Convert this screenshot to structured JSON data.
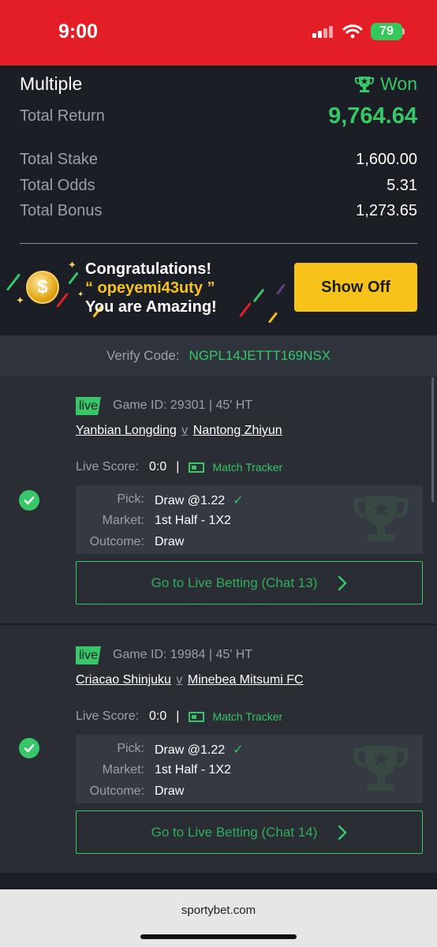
{
  "status_bar": {
    "time": "9:00",
    "battery": "79"
  },
  "summary": {
    "bet_type": "Multiple",
    "status": "Won",
    "total_return_label": "Total Return",
    "total_return": "9,764.64",
    "rows": [
      {
        "label": "Total Stake",
        "value": "1,600.00"
      },
      {
        "label": "Total Odds",
        "value": "5.31"
      },
      {
        "label": "Total Bonus",
        "value": "1,273.65"
      }
    ]
  },
  "congrats": {
    "title": "Congratulations!",
    "user": "“ opeyemi43uty ”",
    "subtitle": "You are Amazing!",
    "button": "Show Off"
  },
  "verify": {
    "label": "Verify Code:",
    "code": "NGPL14JETTT169NSX"
  },
  "games": [
    {
      "live": "live",
      "game_id": "Game ID: 29301 | 45' HT",
      "home": "Yanbian Longding",
      "vs": "v",
      "away": "Nantong Zhiyun",
      "live_score_label": "Live Score:",
      "score": "0:0",
      "separator": "|",
      "tracker": "Match Tracker",
      "pick_label": "Pick:",
      "pick": "Draw @1.22",
      "market_label": "Market:",
      "market": "1st Half - 1X2",
      "outcome_label": "Outcome:",
      "outcome": "Draw",
      "button": "Go to Live Betting (Chat 13)"
    },
    {
      "live": "live",
      "game_id": "Game ID: 19984 | 45' HT",
      "home": "Criacao Shinjuku",
      "vs": "v",
      "away": "Minebea Mitsumi FC",
      "live_score_label": "Live Score:",
      "score": "0:0",
      "separator": "|",
      "tracker": "Match Tracker",
      "pick_label": "Pick:",
      "pick": "Draw @1.22",
      "market_label": "Market:",
      "market": "1st Half - 1X2",
      "outcome_label": "Outcome:",
      "outcome": "Draw",
      "button": "Go to Live Betting (Chat 14)"
    }
  ],
  "footer": {
    "url": "sportybet.com"
  },
  "colors": {
    "brand_red": "#e41e26",
    "accent_green": "#37c768",
    "highlight_yellow": "#f7c21a"
  },
  "icons": [
    "trophy-icon",
    "coin-icon",
    "check-circle-icon",
    "tick-icon",
    "match-tracker-icon",
    "chevron-right-icon",
    "wifi-icon",
    "signal-icon",
    "battery-icon"
  ]
}
